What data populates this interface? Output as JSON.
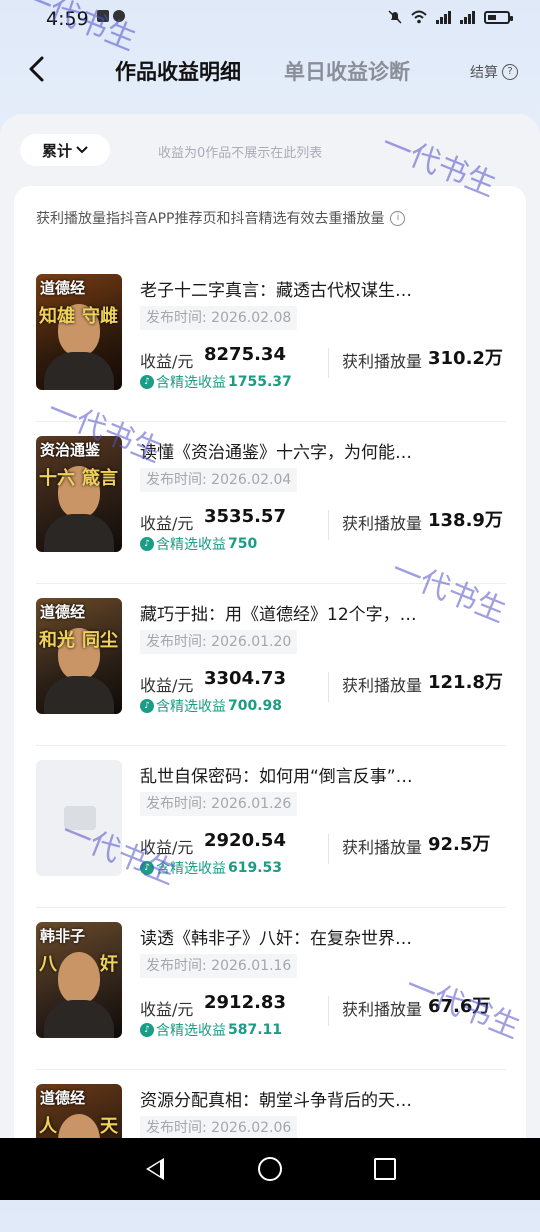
{
  "status_bar": {
    "time": "4:59"
  },
  "header": {
    "tab_active": "作品收益明细",
    "tab_inactive": "单日收益诊断",
    "settle_label": "结算"
  },
  "filter": {
    "selected": "累计",
    "hint": "收益为0作品不展示在此列表"
  },
  "note": "获利播放量指抖音APP推荐页和抖音精选有效去重播放量",
  "labels": {
    "publish_prefix": "发布时间:",
    "revenue": "收益/元",
    "selected_rev": "含精选收益",
    "plays": "获利播放量"
  },
  "items": [
    {
      "title": "老子十二字真言：藏透古代权谋生…",
      "date": "2026.02.08",
      "revenue": "8275.34",
      "selected_rev": "1755.37",
      "plays": "310.2万",
      "thumb": {
        "cap": "道德经",
        "left": "知雄",
        "right": "守雌"
      }
    },
    {
      "title": "读懂《资治通鉴》十六字，为何能…",
      "date": "2026.02.04",
      "revenue": "3535.57",
      "selected_rev": "750",
      "plays": "138.9万",
      "thumb": {
        "cap": "资治通鉴",
        "left": "十六",
        "right": "箴言"
      }
    },
    {
      "title": "藏巧于拙：用《道德经》12个字，…",
      "date": "2026.01.20",
      "revenue": "3304.73",
      "selected_rev": "700.98",
      "plays": "121.8万",
      "thumb": {
        "cap": "道德经",
        "left": "和光",
        "right": "同尘"
      }
    },
    {
      "title": "乱世自保密码：如何用“倒言反事”…",
      "date": "2026.01.26",
      "revenue": "2920.54",
      "selected_rev": "619.53",
      "plays": "92.5万",
      "thumb": null
    },
    {
      "title": "读透《韩非子》八奸：在复杂世界…",
      "date": "2026.01.16",
      "revenue": "2912.83",
      "selected_rev": "587.11",
      "plays": "67.6万",
      "thumb": {
        "cap": "韩非子",
        "left": "八",
        "right": "奸"
      }
    },
    {
      "title": "资源分配真相：朝堂斗争背后的天…",
      "date": "2026.02.06",
      "revenue": "",
      "selected_rev": "",
      "plays": "",
      "thumb": {
        "cap": "道德经",
        "left": "人",
        "right": "天"
      }
    }
  ],
  "watermark": "一代书生"
}
